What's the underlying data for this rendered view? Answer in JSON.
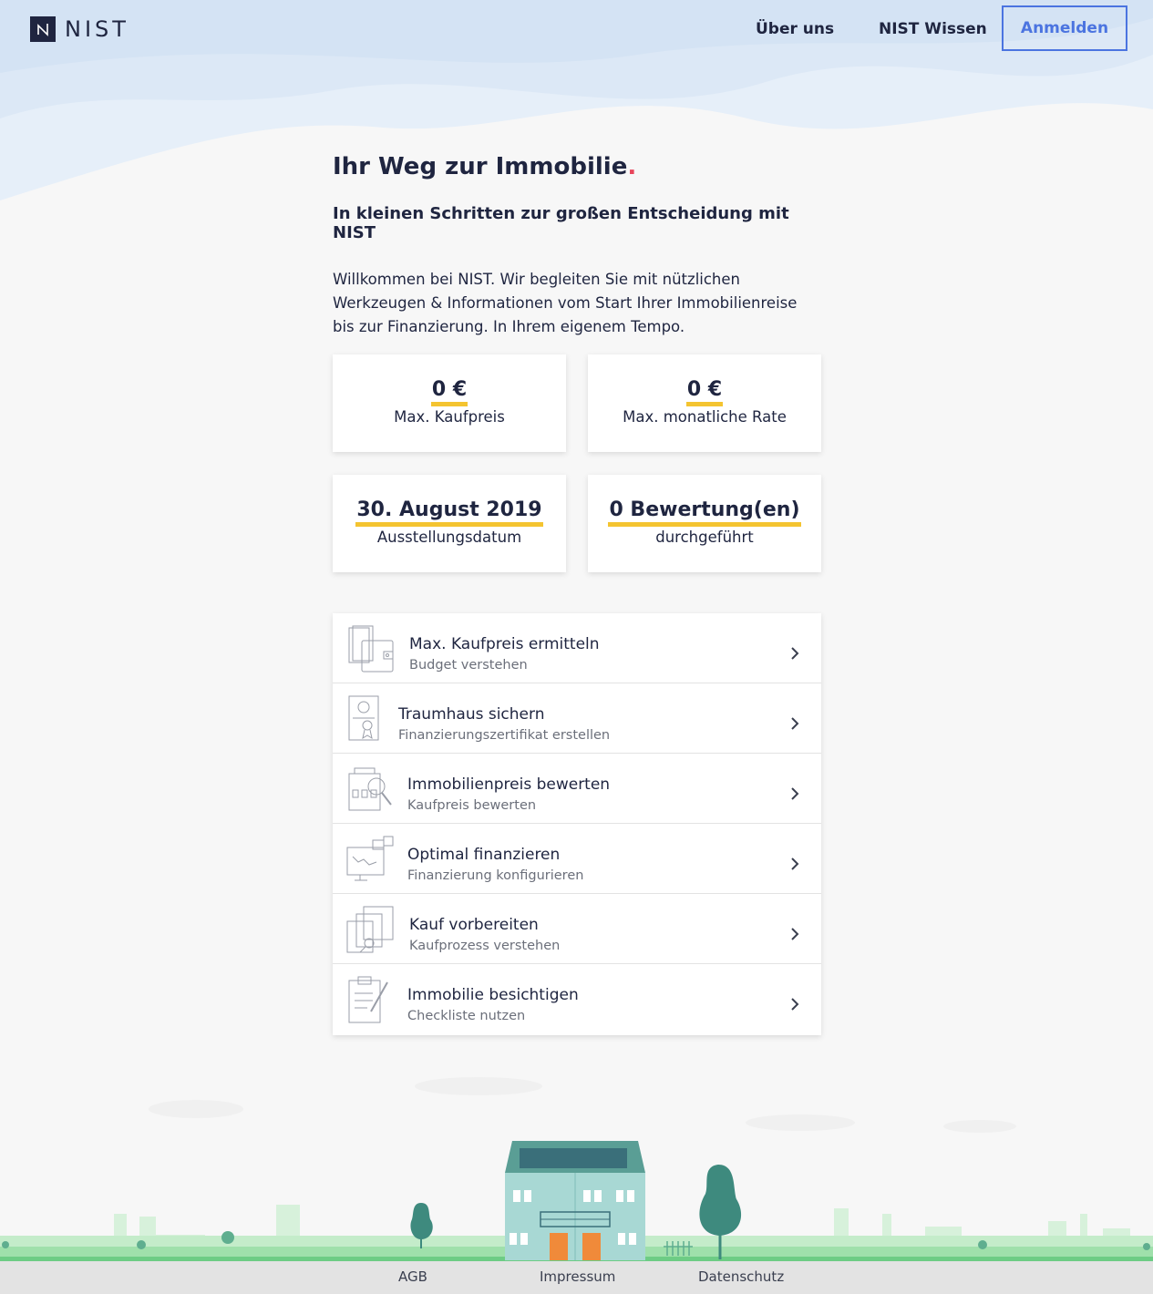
{
  "header": {
    "logo_text": "NIST",
    "nav": {
      "about": "Über uns",
      "knowledge": "NIST Wissen"
    },
    "login_label": "Anmelden"
  },
  "hero": {
    "title": "Ihr Weg zur Immobilie",
    "title_dot": ".",
    "subtitle": "In kleinen Schritten zur großen Entscheidung mit NIST",
    "intro": "Willkommen bei NIST. Wir begleiten Sie mit nützlichen Werkzeugen & Informationen vom Start Ihrer Immobilienreise bis zur Finanzierung. In Ihrem eigenem Tempo."
  },
  "stats": [
    {
      "value": "0 €",
      "label": "Max. Kaufpreis"
    },
    {
      "value": "0 €",
      "label": "Max. monatliche Rate"
    },
    {
      "value": "30. August 2019",
      "label": "Ausstellungsdatum"
    },
    {
      "value": "0 Bewertung(en)",
      "label": "durchgeführt"
    }
  ],
  "steps": [
    {
      "title": "Max. Kaufpreis ermitteln",
      "subtitle": "Budget verstehen",
      "icon": "wallet-documents-icon"
    },
    {
      "title": "Traumhaus sichern",
      "subtitle": "Finanzierungszertifikat erstellen",
      "icon": "certificate-icon"
    },
    {
      "title": "Immobilienpreis bewerten",
      "subtitle": "Kaufpreis bewerten",
      "icon": "building-magnifier-icon"
    },
    {
      "title": "Optimal finanzieren",
      "subtitle": "Finanzierung konfigurieren",
      "icon": "chart-percent-icon"
    },
    {
      "title": "Kauf vorbereiten",
      "subtitle": "Kaufprozess verstehen",
      "icon": "documents-stamp-icon"
    },
    {
      "title": "Immobilie besichtigen",
      "subtitle": "Checkliste nutzen",
      "icon": "clipboard-pen-icon"
    }
  ],
  "footer": {
    "links": [
      "AGB",
      "Impressum",
      "Datenschutz"
    ]
  },
  "colors": {
    "primary": "#1f2540",
    "accent": "#4b74e0",
    "highlight": "#f4c430",
    "dot": "#e8455b",
    "house": "#a8d8d4",
    "tree": "#3e8a7e",
    "grass": "#8fdc9d"
  }
}
